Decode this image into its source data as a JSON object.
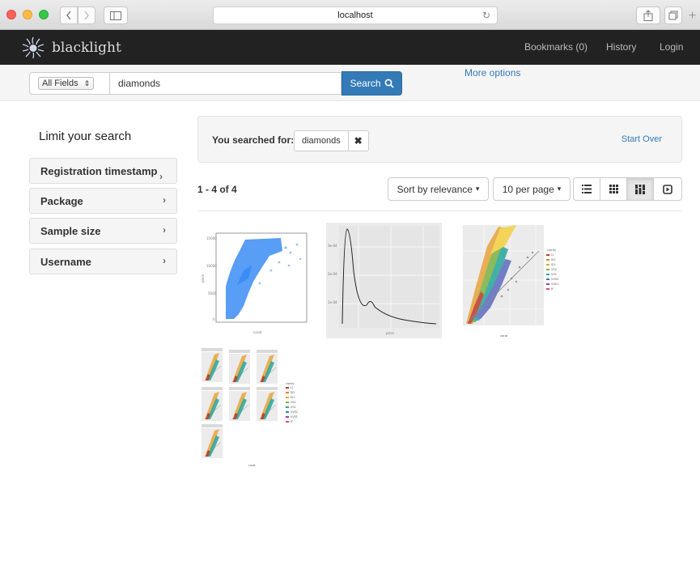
{
  "browser": {
    "url": "localhost",
    "reload_icon": "↻"
  },
  "navbar": {
    "brand": "blacklight",
    "links": [
      "Bookmarks (0)",
      "History",
      "Login"
    ]
  },
  "search": {
    "field_select": "All Fields",
    "field_select_arrows": "⇕",
    "query": "diamonds",
    "button_label": "Search",
    "more_options": "More options"
  },
  "sidebar": {
    "title": "Limit your search",
    "facets": [
      {
        "label": "Registration timestamp"
      },
      {
        "label": "Package"
      },
      {
        "label": "Sample size"
      },
      {
        "label": "Username"
      }
    ],
    "chevron": "›"
  },
  "constraints": {
    "label": "You searched for:",
    "query_value": "diamonds",
    "remove": "✖",
    "start_over": "Start Over"
  },
  "results": {
    "count": "1 - 4 of 4",
    "sort": "Sort by relevance",
    "per_page": "10 per page",
    "caret": "▾",
    "views": [
      "list",
      "gallery",
      "masonry",
      "slideshow"
    ],
    "active_view": "masonry"
  },
  "colors": {
    "link": "#337ab7",
    "navbar_bg": "#222222",
    "scatter_blue": "#3b8cf4"
  },
  "icons": {
    "search": "search-icon",
    "brand": "blacklight-sun-icon",
    "sidebar": "sidebar-icon",
    "share": "share-icon",
    "tabs": "tabs-icon"
  }
}
